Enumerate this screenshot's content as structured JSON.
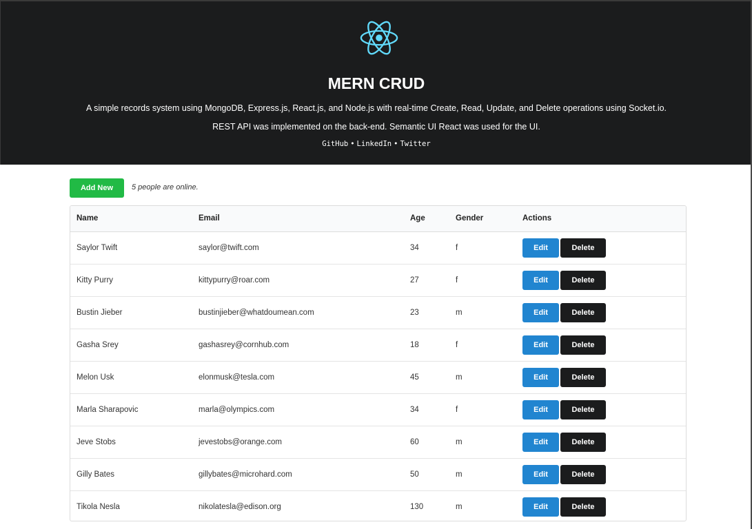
{
  "header": {
    "title": "MERN CRUD",
    "description_line1": "A simple records system using MongoDB, Express.js, React.js, and Node.js with real-time Create, Read, Update, and Delete operations using Socket.io.",
    "description_line2": "REST API was implemented on the back-end. Semantic UI React was used for the UI.",
    "links": [
      "GitHub",
      "LinkedIn",
      "Twitter"
    ],
    "separator": "•",
    "logo_icon": "react-atom-icon",
    "logo_color": "#61dafb"
  },
  "toolbar": {
    "add_label": "Add New",
    "online_text": "5 people are online."
  },
  "table": {
    "columns": [
      "Name",
      "Email",
      "Age",
      "Gender",
      "Actions"
    ],
    "edit_label": "Edit",
    "delete_label": "Delete",
    "rows": [
      {
        "name": "Saylor Twift",
        "email": "saylor@twift.com",
        "age": "34",
        "gender": "f"
      },
      {
        "name": "Kitty Purry",
        "email": "kittypurry@roar.com",
        "age": "27",
        "gender": "f"
      },
      {
        "name": "Bustin Jieber",
        "email": "bustinjieber@whatdoumean.com",
        "age": "23",
        "gender": "m"
      },
      {
        "name": "Gasha Srey",
        "email": "gashasrey@cornhub.com",
        "age": "18",
        "gender": "f"
      },
      {
        "name": "Melon Usk",
        "email": "elonmusk@tesla.com",
        "age": "45",
        "gender": "m"
      },
      {
        "name": "Marla Sharapovic",
        "email": "marla@olympics.com",
        "age": "34",
        "gender": "f"
      },
      {
        "name": "Jeve Stobs",
        "email": "jevestobs@orange.com",
        "age": "60",
        "gender": "m"
      },
      {
        "name": "Gilly Bates",
        "email": "gillybates@microhard.com",
        "age": "50",
        "gender": "m"
      },
      {
        "name": "Tikola Nesla",
        "email": "nikolatesla@edison.org",
        "age": "130",
        "gender": "m"
      }
    ]
  },
  "colors": {
    "header_bg": "#1b1c1d",
    "add_button": "#21ba45",
    "edit_button": "#2185d0",
    "delete_button": "#1b1c1d"
  }
}
